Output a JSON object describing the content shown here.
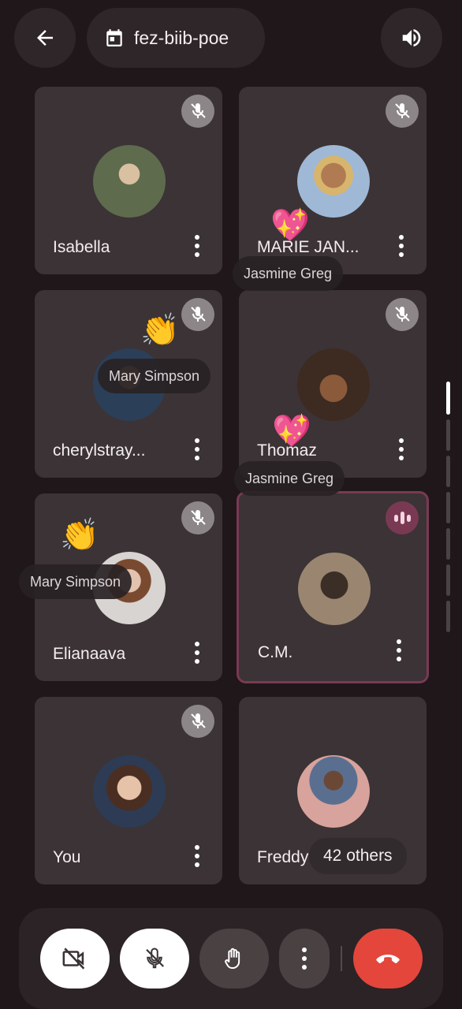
{
  "header": {
    "back_icon": "arrow-left-icon",
    "meeting_code": "fez-biib-poe",
    "calendar_icon": "calendar-icon",
    "speaker_icon": "volume-icon"
  },
  "tiles": [
    {
      "name": "Isabella",
      "muted": true,
      "avatar_color": "#7d8a6a"
    },
    {
      "name": "MARIE JAN...",
      "muted": true,
      "avatar_color": "#8aa6c4"
    },
    {
      "name": "cherylstray...",
      "muted": true,
      "avatar_color": "#3a5570"
    },
    {
      "name": "Thomaz",
      "muted": true,
      "avatar_color": "#5a4334"
    },
    {
      "name": "Elianaava",
      "muted": true,
      "avatar_color": "#b5473f"
    },
    {
      "name": "C.M.",
      "muted": false,
      "speaking": true,
      "avatar_color": "#6b5a44"
    },
    {
      "name": "You",
      "muted": true,
      "avatar_color": "#8d5e48"
    },
    {
      "name": "Freddy",
      "muted": false,
      "avatar_color": "#5d6f8c"
    }
  ],
  "overlays": {
    "reaction_1_user": "Jasmine Greg",
    "reaction_2_user": "Mary Simpson",
    "reaction_3_user": "Jasmine Greg",
    "reaction_4_user": "Mary Simpson",
    "others_count": "42 others",
    "heart_emoji": "💖",
    "clap_emoji": "👏"
  },
  "controls": {
    "camera": "camera-off-icon",
    "mic": "mic-off-icon",
    "hand": "raise-hand-icon",
    "more": "more-vert-icon",
    "end_call": "end-call-icon"
  },
  "colors": {
    "background": "#1f1719",
    "tile": "#3b3335",
    "speaking_border": "#7a3953",
    "end_call": "#e4463b"
  }
}
